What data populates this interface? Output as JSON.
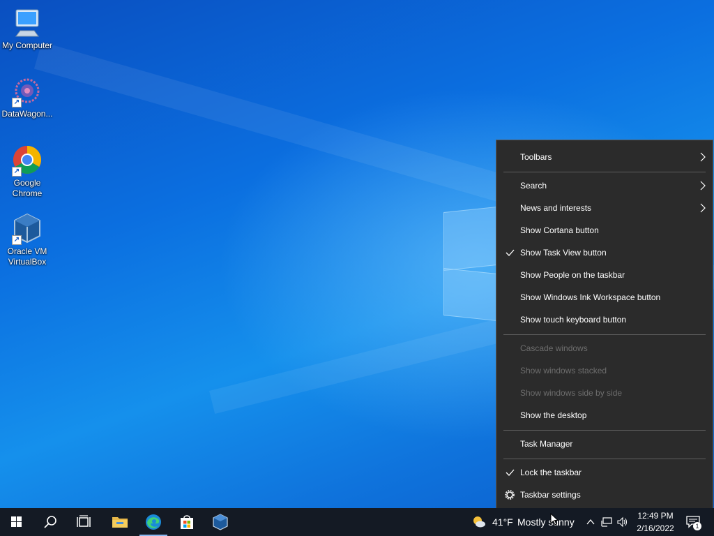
{
  "desktop": {
    "icons": [
      {
        "label": "My Computer"
      },
      {
        "label": "DataWagon..."
      },
      {
        "label": "Google Chrome"
      },
      {
        "label": "Oracle VM VirtualBox"
      }
    ]
  },
  "context_menu": {
    "items": [
      {
        "label": "Toolbars",
        "submenu": true,
        "checked": false,
        "disabled": false
      },
      {
        "label": "Search",
        "submenu": true,
        "checked": false,
        "disabled": false
      },
      {
        "label": "News and interests",
        "submenu": true,
        "checked": false,
        "disabled": false
      },
      {
        "label": "Show Cortana button",
        "submenu": false,
        "checked": false,
        "disabled": false
      },
      {
        "label": "Show Task View button",
        "submenu": false,
        "checked": true,
        "disabled": false
      },
      {
        "label": "Show People on the taskbar",
        "submenu": false,
        "checked": false,
        "disabled": false
      },
      {
        "label": "Show Windows Ink Workspace button",
        "submenu": false,
        "checked": false,
        "disabled": false
      },
      {
        "label": "Show touch keyboard button",
        "submenu": false,
        "checked": false,
        "disabled": false
      },
      {
        "label": "Cascade windows",
        "submenu": false,
        "checked": false,
        "disabled": true
      },
      {
        "label": "Show windows stacked",
        "submenu": false,
        "checked": false,
        "disabled": true
      },
      {
        "label": "Show windows side by side",
        "submenu": false,
        "checked": false,
        "disabled": true
      },
      {
        "label": "Show the desktop",
        "submenu": false,
        "checked": false,
        "disabled": false
      },
      {
        "label": "Task Manager",
        "submenu": false,
        "checked": false,
        "disabled": false
      },
      {
        "label": "Lock the taskbar",
        "submenu": false,
        "checked": true,
        "disabled": false
      },
      {
        "label": "Taskbar settings",
        "submenu": false,
        "checked": false,
        "disabled": false,
        "icon": "gear-icon"
      }
    ]
  },
  "taskbar": {
    "apps": [
      "start-icon",
      "search-icon",
      "task-view-icon",
      "file-explorer-icon",
      "edge-icon",
      "store-icon",
      "virtualbox-icon"
    ],
    "weather": {
      "temp": "41°F",
      "condition": "Mostly sunny"
    },
    "clock": {
      "time": "12:49 PM",
      "date": "2/16/2022"
    },
    "notification_count": "1"
  },
  "colors": {
    "menu_bg": "#2b2b2b",
    "taskbar_bg": "#141a24",
    "disabled_text": "#6d6d6d",
    "accent": "#0078d7"
  }
}
